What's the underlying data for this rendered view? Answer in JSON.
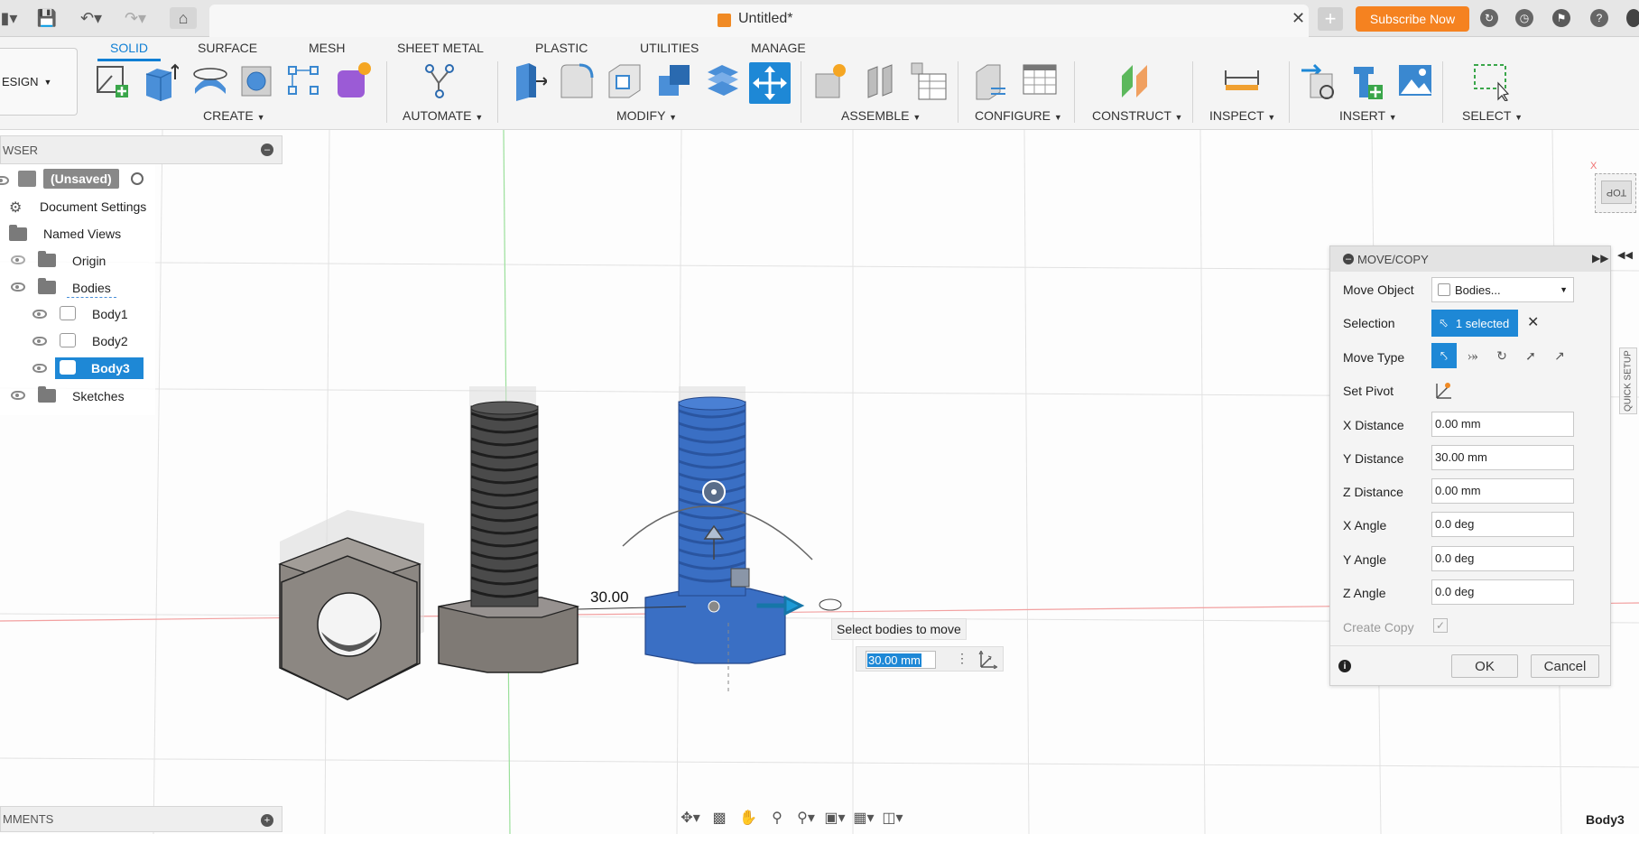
{
  "titlebar": {
    "doc_title": "Untitled*",
    "subscribe_label": "Subscribe Now"
  },
  "ribbon": {
    "workspace_label": "ESIGN",
    "tabs": [
      "SOLID",
      "SURFACE",
      "MESH",
      "SHEET METAL",
      "PLASTIC",
      "UTILITIES",
      "MANAGE"
    ],
    "active_tab": "SOLID",
    "groups": [
      "CREATE",
      "AUTOMATE",
      "MODIFY",
      "ASSEMBLE",
      "CONFIGURE",
      "CONSTRUCT",
      "INSPECT",
      "INSERT",
      "SELECT"
    ]
  },
  "browser": {
    "header": "WSER",
    "root": "(Unsaved)",
    "items": [
      "Document Settings",
      "Named Views",
      "Origin",
      "Bodies",
      "Body1",
      "Body2",
      "Body3",
      "Sketches"
    ],
    "selected_item": "Body3"
  },
  "comments": {
    "header": "MMENTS"
  },
  "viewport": {
    "dimension_label": "30.00",
    "tooltip": "Select bodies to move",
    "input_value": "30.00 mm",
    "viewcube_label": "TOP"
  },
  "move_copy": {
    "title": "MOVE/COPY",
    "move_object_label": "Move Object",
    "move_object_value": "Bodies...",
    "selection_label": "Selection",
    "selection_value": "1 selected",
    "move_type_label": "Move Type",
    "set_pivot_label": "Set Pivot",
    "fields": [
      {
        "label": "X Distance",
        "value": "0.00 mm"
      },
      {
        "label": "Y Distance",
        "value": "30.00 mm"
      },
      {
        "label": "Z Distance",
        "value": "0.00 mm"
      },
      {
        "label": "X Angle",
        "value": "0.0 deg"
      },
      {
        "label": "Y Angle",
        "value": "0.0 deg"
      },
      {
        "label": "Z Angle",
        "value": "0.0 deg"
      }
    ],
    "create_copy_label": "Create Copy",
    "create_copy_checked": true,
    "ok_label": "OK",
    "cancel_label": "Cancel"
  },
  "quick_setup_label": "QUICK SETUP",
  "status": {
    "selected_body": "Body3"
  },
  "colors": {
    "accent": "#0f7fd4",
    "selection_blue": "#1e88d6",
    "body_blue": "#3a6fc4",
    "subscribe_orange": "#f58220"
  }
}
